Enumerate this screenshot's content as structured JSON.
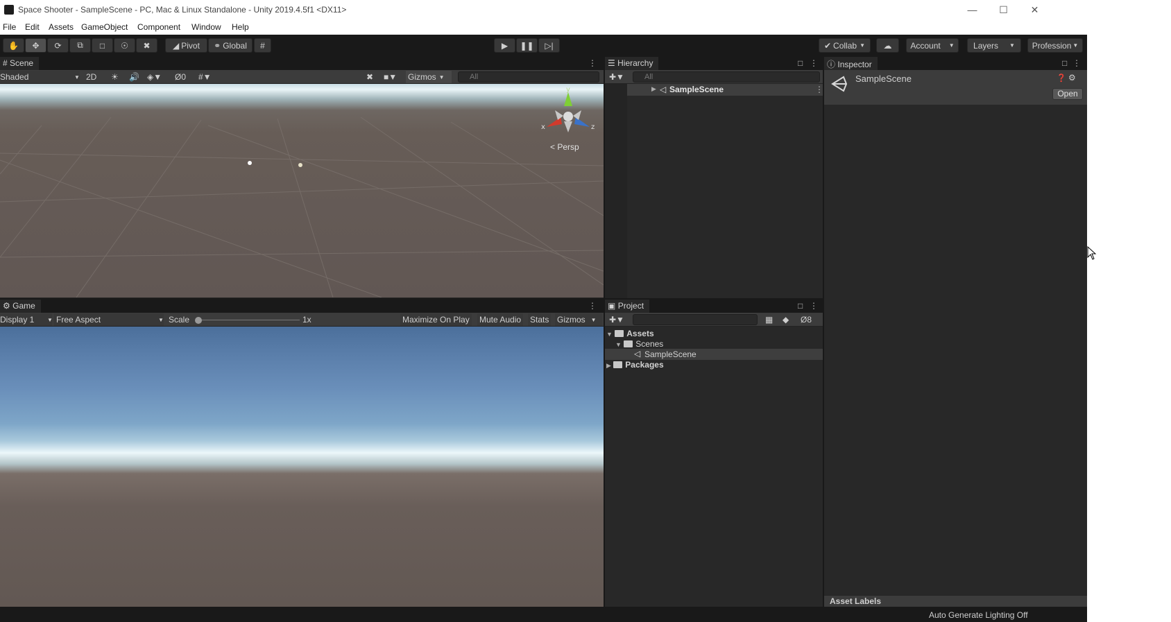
{
  "window": {
    "title": "Space Shooter - SampleScene - PC, Mac & Linux Standalone - Unity 2019.4.5f1 <DX11>"
  },
  "menu": [
    "File",
    "Edit",
    "Assets",
    "GameObject",
    "Component",
    "Window",
    "Help"
  ],
  "toolbar": {
    "pivot_label": "Pivot",
    "global_label": "Global",
    "collab_label": "Collab",
    "account_label": "Account",
    "layers_label": "Layers",
    "layout_label": "Profession"
  },
  "scene": {
    "tab_label": "Scene",
    "shading": "Shaded",
    "mode_2d": "2D",
    "hidden_count": "0",
    "gizmos_label": "Gizmos",
    "search_placeholder": "All",
    "persp_label": "Persp",
    "axis_x": "x",
    "axis_y": "y",
    "axis_z": "z"
  },
  "game": {
    "tab_label": "Game",
    "display": "Display 1",
    "aspect": "Free Aspect",
    "scale_label": "Scale",
    "scale_value": "1x",
    "maximize_label": "Maximize On Play",
    "mute_label": "Mute Audio",
    "stats_label": "Stats",
    "gizmos_label": "Gizmos"
  },
  "hierarchy": {
    "tab_label": "Hierarchy",
    "search_placeholder": "All",
    "items": [
      {
        "label": "SampleScene"
      }
    ]
  },
  "project": {
    "tab_label": "Project",
    "hidden_count": "8",
    "tree": [
      {
        "label": "Assets"
      },
      {
        "label": "Scenes"
      },
      {
        "label": "SampleScene"
      },
      {
        "label": "Packages"
      }
    ]
  },
  "inspector": {
    "tab_label": "Inspector",
    "asset_name": "SampleScene",
    "open_label": "Open",
    "asset_labels": "Asset Labels"
  },
  "status": {
    "lighting": "Auto Generate Lighting Off"
  }
}
